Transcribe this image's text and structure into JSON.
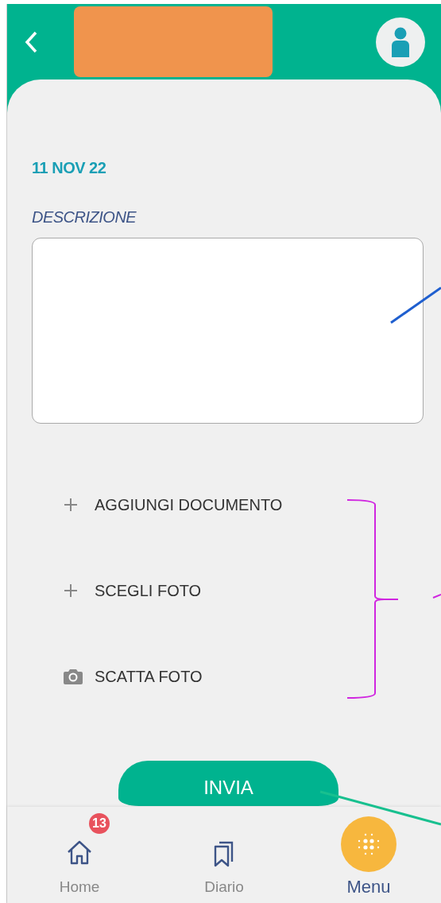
{
  "header": {
    "kind": "redacted"
  },
  "date": "11 NOV 22",
  "description": {
    "label": "DESCRIZIONE"
  },
  "actions": [
    {
      "kind": "add",
      "label": "AGGIUNGI DOCUMENTO"
    },
    {
      "kind": "add",
      "label": "SCEGLI FOTO"
    },
    {
      "kind": "camera",
      "label": "SCATTA FOTO"
    }
  ],
  "submit": "INVIA",
  "nav": [
    {
      "kind": "home",
      "label": "Home",
      "badge": "13",
      "selected": false
    },
    {
      "kind": "diary",
      "label": "Diario",
      "selected": false
    },
    {
      "kind": "menu",
      "label": "Menu",
      "selected": true
    }
  ]
}
